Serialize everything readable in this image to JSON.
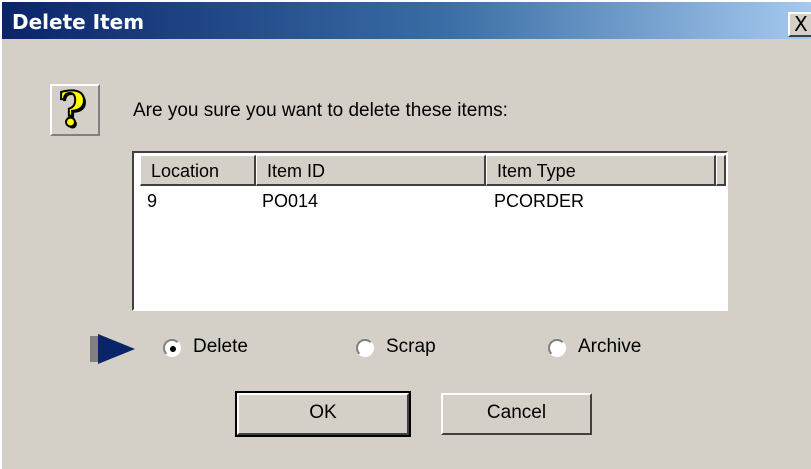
{
  "window": {
    "title": "Delete Item",
    "close_glyph": "X"
  },
  "icons": {
    "question": "question-mark-icon",
    "question_glyph": "?",
    "pointer": "arrow-right-icon"
  },
  "prompt": "Are you sure you want to delete these items:",
  "table": {
    "columns": [
      "Location",
      "Item ID",
      "Item Type"
    ],
    "rows": [
      [
        "9",
        "PO014",
        "PCORDER"
      ]
    ]
  },
  "options": {
    "selected": "Delete",
    "items": [
      "Delete",
      "Scrap",
      "Archive"
    ]
  },
  "buttons": {
    "ok": "OK",
    "cancel": "Cancel"
  },
  "colors": {
    "titlebar_start": "#0a246a",
    "titlebar_end": "#a6caf0",
    "pointer_arrow": "#0a246a"
  }
}
